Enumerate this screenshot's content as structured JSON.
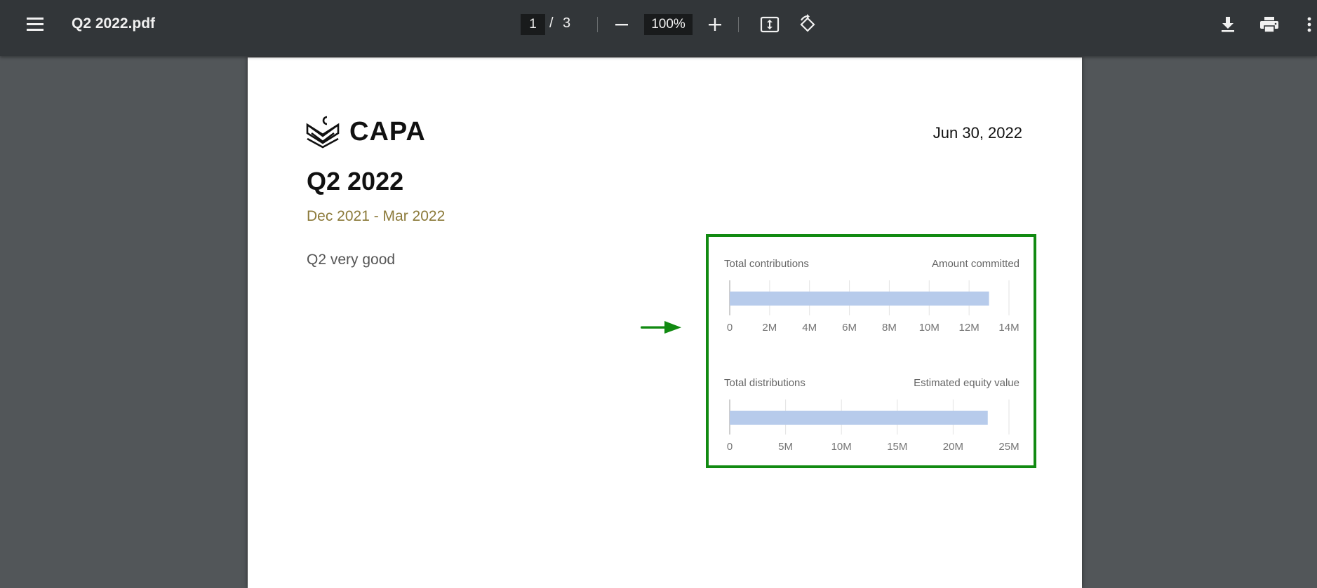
{
  "toolbar": {
    "file_name": "Q2 2022.pdf",
    "current_page": "1",
    "page_separator": "/",
    "total_pages": "3",
    "zoom": "100%"
  },
  "document": {
    "logo_text": "CAPA",
    "date": "Jun 30, 2022",
    "title": "Q2 2022",
    "period": "Dec 2021 - Mar 2022",
    "note": "Q2 very good"
  },
  "colors": {
    "toolbar_bg": "#323639",
    "viewer_bg": "#525659",
    "period_text": "#8c7a3a",
    "bar_fill": "#b7cbeb",
    "highlight": "#118a11"
  },
  "chart_data": [
    {
      "type": "bar",
      "orientation": "horizontal",
      "left_label": "Total contributions",
      "right_label": "Amount committed",
      "values": [
        13000000
      ],
      "xlim": [
        0,
        14000000
      ],
      "ticks": [
        "0",
        "2M",
        "4M",
        "6M",
        "8M",
        "10M",
        "12M",
        "14M"
      ],
      "grid": true
    },
    {
      "type": "bar",
      "orientation": "horizontal",
      "left_label": "Total distributions",
      "right_label": "Estimated equity value",
      "values": [
        23100000
      ],
      "xlim": [
        0,
        25000000
      ],
      "ticks": [
        "0",
        "5M",
        "10M",
        "15M",
        "20M",
        "25M"
      ],
      "grid": true
    }
  ]
}
